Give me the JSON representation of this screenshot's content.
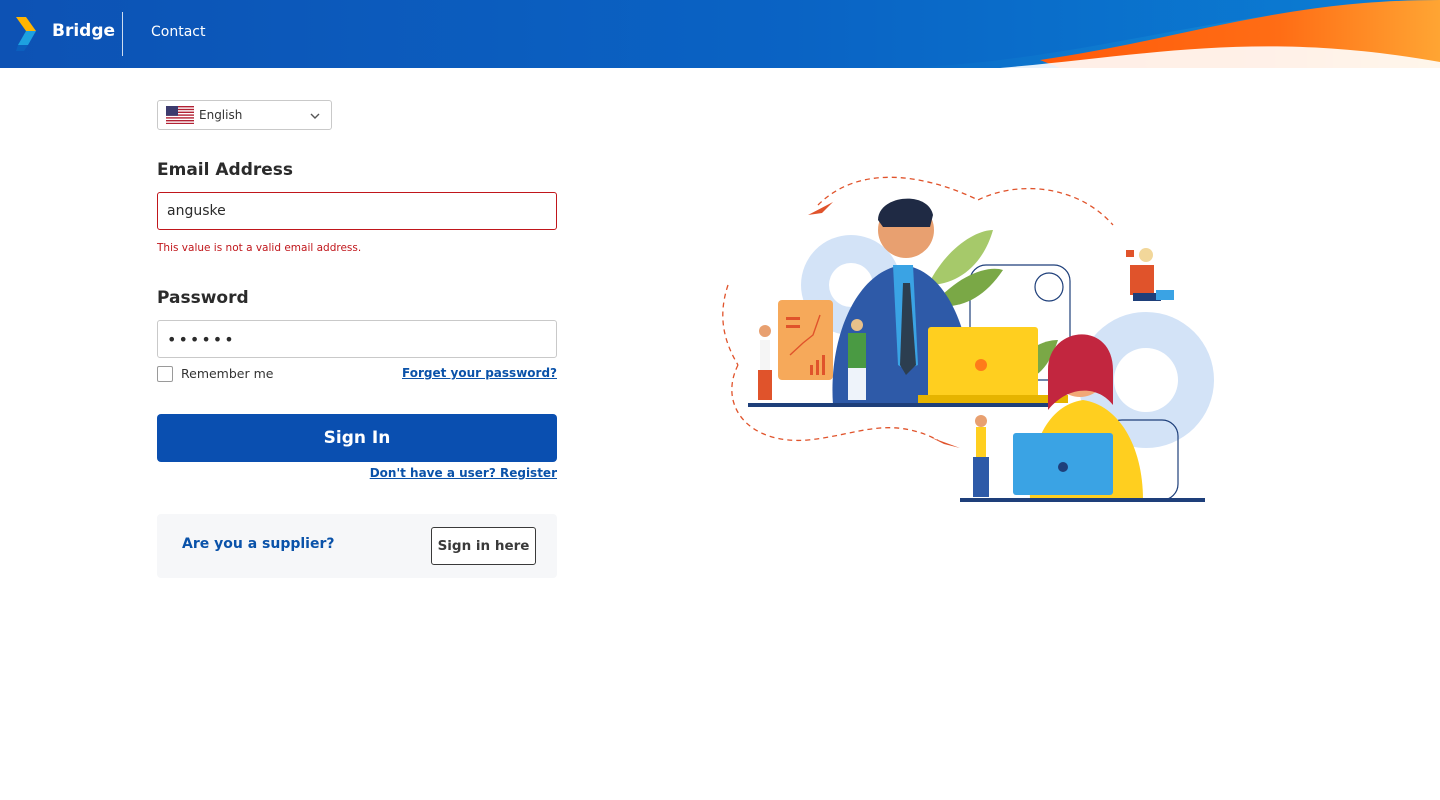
{
  "header": {
    "brand": "Bridge",
    "nav_contact": "Contact"
  },
  "language": {
    "selected": "English",
    "flag_icon": "us-flag-icon"
  },
  "form": {
    "email_label": "Email Address",
    "email_value": "anguske",
    "email_error": "This value is not a valid email address.",
    "password_label": "Password",
    "password_value": "••••••",
    "remember_label": "Remember me",
    "remember_checked": false,
    "forgot_link": "Forget your password?",
    "signin_button": "Sign In",
    "register_link": "Don't have a user? Register"
  },
  "supplier": {
    "question": "Are you a supplier?",
    "button": "Sign in here"
  },
  "colors": {
    "primary": "#0a4fb0",
    "link": "#0a52a9",
    "error": "#c0161b",
    "accent_orange": "#ff6a13"
  }
}
